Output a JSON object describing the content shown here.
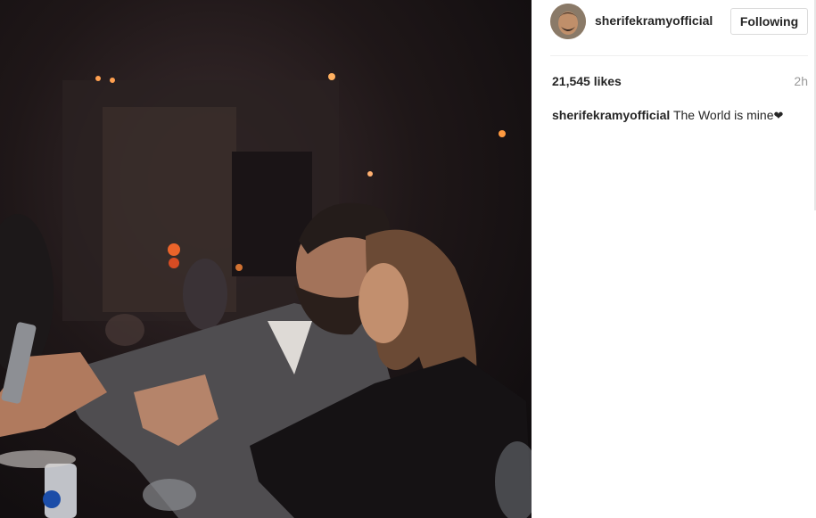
{
  "post": {
    "username": "sherifekramyofficial",
    "follow_label": "Following",
    "likes": "21,545 likes",
    "time": "2h",
    "caption_author": "sherifekramyofficial",
    "caption_text": "The World is mine",
    "caption_emoji": "❤"
  },
  "icons": {
    "avatar": "profile-photo",
    "photo": "post-photo"
  },
  "colors": {
    "text": "#262626",
    "muted": "#999999",
    "border": "#dbdbdb"
  }
}
